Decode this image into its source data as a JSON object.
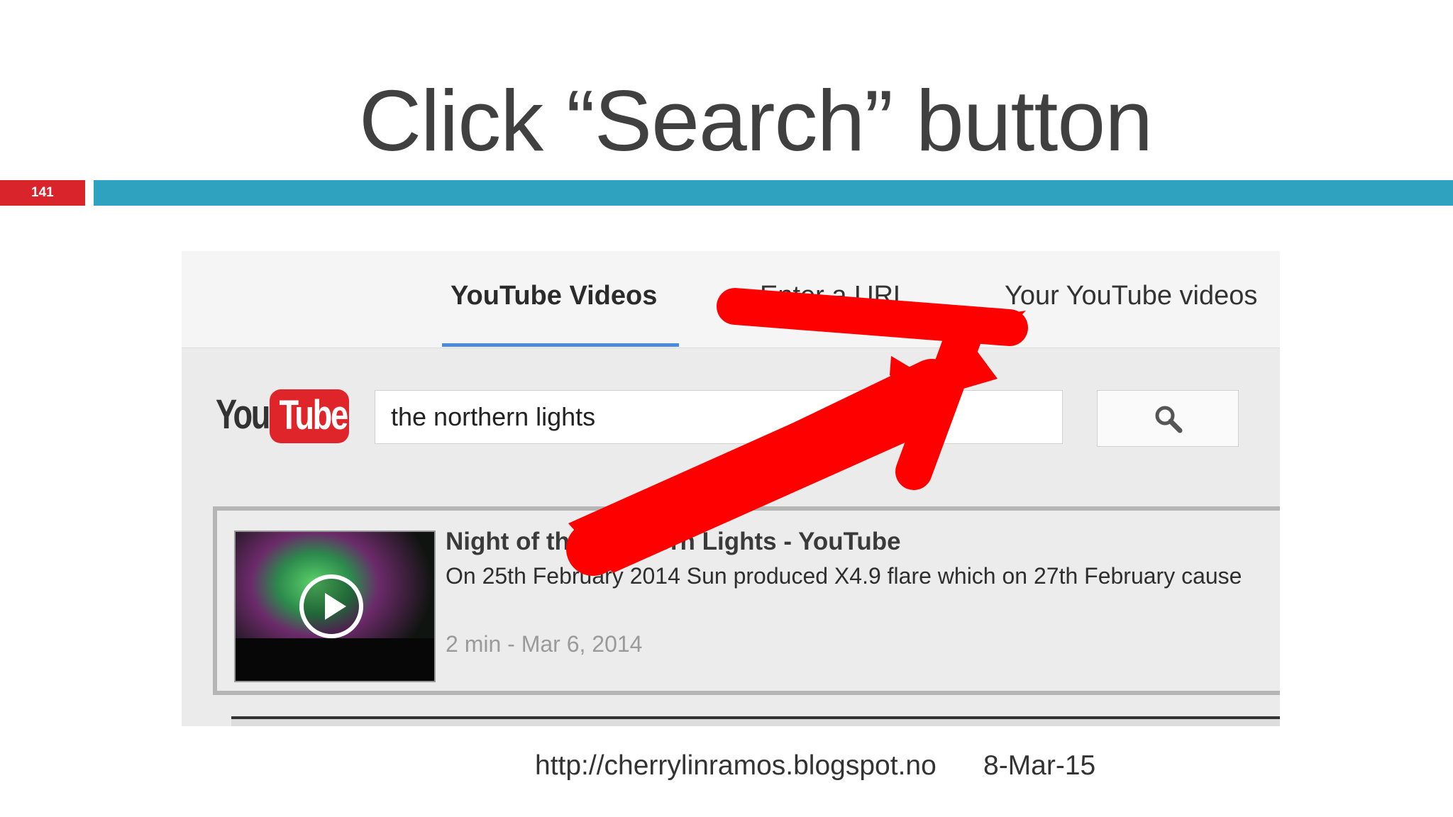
{
  "slide": {
    "title": "Click “Search” button",
    "number": "141",
    "footer_url": "http://cherrylinramos.blogspot.no",
    "footer_date": "8-Mar-15"
  },
  "tabs": [
    {
      "label": "YouTube Videos",
      "active": true
    },
    {
      "label": "Enter a URL",
      "active": false
    },
    {
      "label": "Your YouTube videos",
      "active": false
    }
  ],
  "logo": {
    "you": "You",
    "tube": "Tube"
  },
  "search": {
    "value": "the northern lights",
    "button_icon": "search-icon"
  },
  "results": [
    {
      "title": "Night of the Northern Lights - YouTube",
      "description": "On 25th February 2014 Sun produced X4.9 flare which on 27th February cause",
      "meta": "2 min - Mar 6, 2014"
    }
  ],
  "colors": {
    "accent_bar": "#2ea2bf",
    "number_bar": "#d9242b",
    "arrow": "#ff0000",
    "tab_underline": "#4a8be0"
  }
}
